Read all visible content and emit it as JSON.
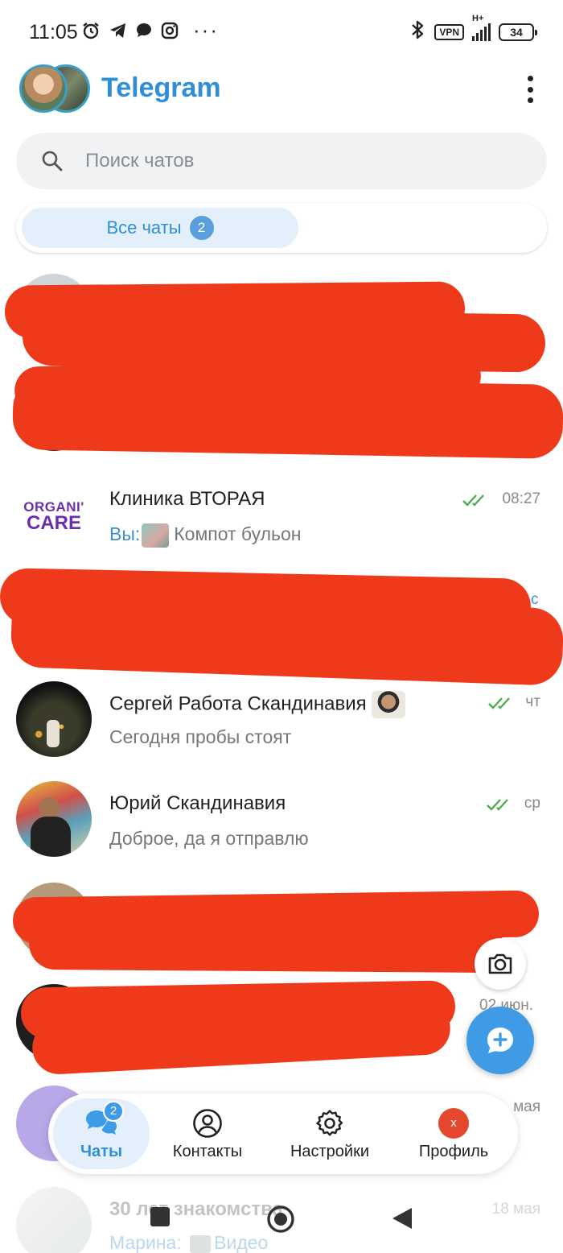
{
  "status_bar": {
    "time": "11:05",
    "dots": "···",
    "vpn": "VPN",
    "network": "H+",
    "battery": "34"
  },
  "header": {
    "title": "Telegram"
  },
  "search": {
    "placeholder": "Поиск чатов"
  },
  "folders": {
    "all_label": "Все чаты",
    "all_count": "2"
  },
  "chats": [
    {
      "name": "Клиника ВТОРАЯ",
      "avatar_text_1": "ORGANI'",
      "avatar_text_2": "CARE",
      "sender": "Вы:",
      "preview": "Компот бульон",
      "time": "08:27",
      "read": true
    },
    {
      "name": "Сергей Работа Скандинавия",
      "preview": "Сегодня пробы стоят",
      "time": "чт",
      "read": true
    },
    {
      "name": "Юрий Скандинавия",
      "preview": "Доброе, да я отправлю",
      "time": "ср",
      "read": true
    },
    {
      "name": "30 лет знакомства",
      "sender": "Марина:",
      "preview": "Видео",
      "time": "18 мая"
    }
  ],
  "partial_times": {
    "row_a": "02 июн.",
    "row_b": "мая"
  },
  "bottom_nav": {
    "chats": "Чаты",
    "chats_badge": "2",
    "contacts": "Контакты",
    "settings": "Настройки",
    "profile": "Профиль",
    "profile_initial": "x"
  },
  "colors": {
    "accent": "#2f8ed6",
    "tick_green": "#4cae4f",
    "redaction": "#ee3a1b"
  }
}
